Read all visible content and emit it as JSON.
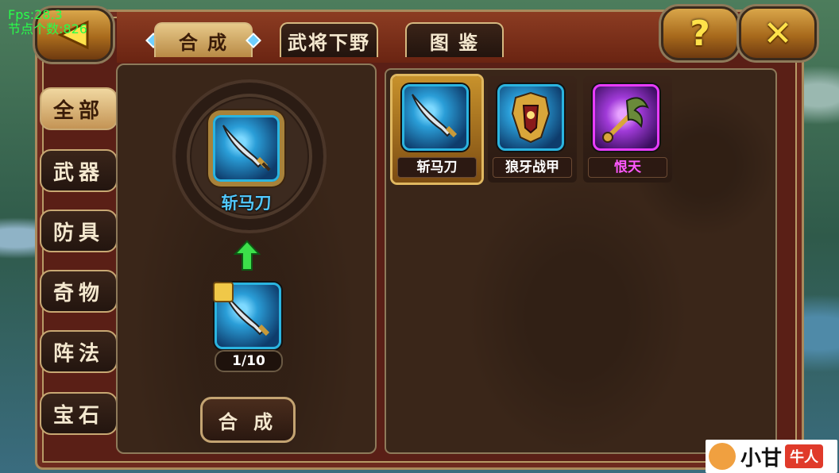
{
  "hud": {
    "fps": "Fps:28.3",
    "nodes": "节点个数:826"
  },
  "top_tabs": [
    {
      "label": "合 成",
      "active": true
    },
    {
      "label": "武将下野",
      "active": false
    },
    {
      "label": "图  鉴",
      "active": false
    }
  ],
  "buttons": {
    "back_icon": "back-arrow-icon",
    "help_label": "?",
    "close_label": "✕",
    "synthesize_label": "合 成"
  },
  "categories": [
    {
      "label": "全部",
      "active": true
    },
    {
      "label": "武器",
      "active": false
    },
    {
      "label": "防具",
      "active": false
    },
    {
      "label": "奇物",
      "active": false
    },
    {
      "label": "阵法",
      "active": false
    },
    {
      "label": "宝石",
      "active": false
    }
  ],
  "synthesis": {
    "target_name": "斩马刀",
    "material_count": "1/10"
  },
  "recipes": [
    {
      "name": "斩马刀",
      "name_color": "#ffffff",
      "selected": true,
      "icon": "saber-icon"
    },
    {
      "name": "狼牙战甲",
      "name_color": "#ffffff",
      "selected": false,
      "icon": "armor-icon"
    },
    {
      "name": "恨天",
      "name_color": "#ff59ff",
      "selected": false,
      "icon": "mace-icon"
    }
  ],
  "watermark": {
    "text": "小甘",
    "badge": "牛人"
  },
  "colors": {
    "accent_blue": "#2ab4e0",
    "accent_purple": "#e83cff",
    "gold": "#c8922c",
    "fps_green": "#29ff4a"
  }
}
